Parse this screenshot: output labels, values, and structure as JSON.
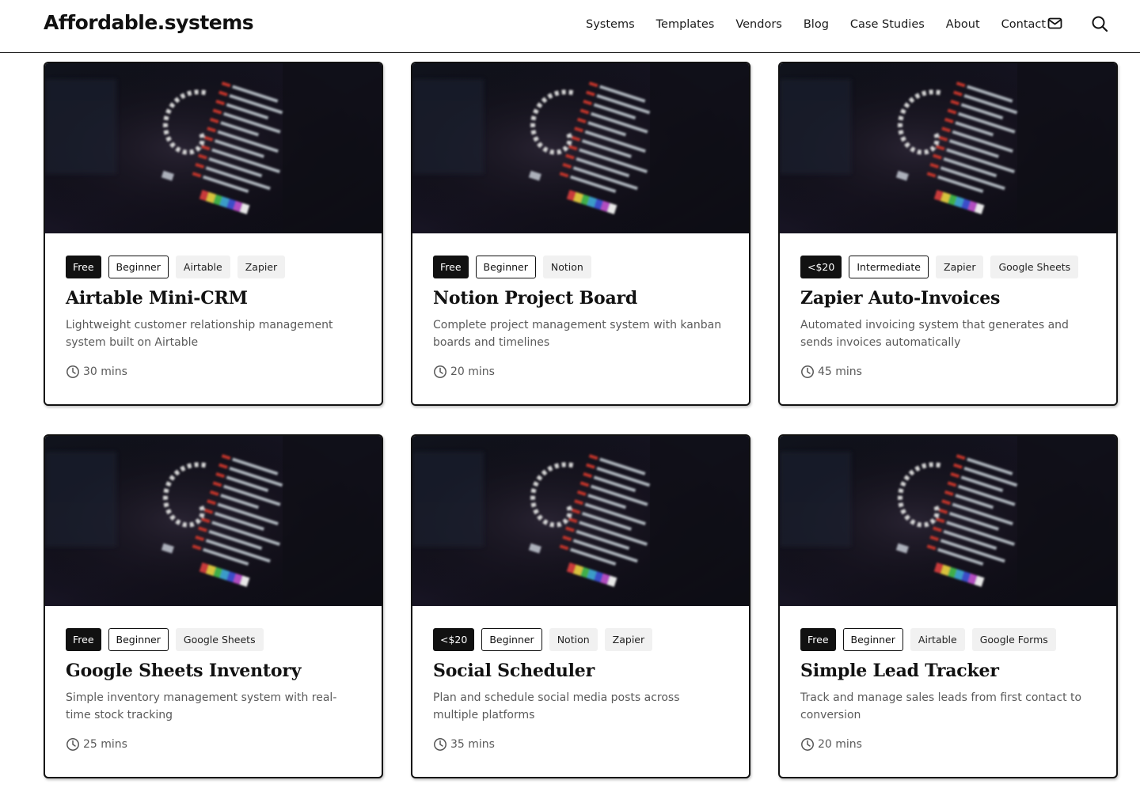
{
  "site": {
    "logo": "Affordable.systems"
  },
  "nav": {
    "links": [
      "Systems",
      "Templates",
      "Vendors",
      "Blog",
      "Case Studies",
      "About",
      "Contact"
    ],
    "mail_icon": "mail-icon",
    "search_icon": "search-icon"
  },
  "cards": [
    {
      "price": "Free",
      "level": "Beginner",
      "tools": [
        "Airtable",
        "Zapier"
      ],
      "title": "Airtable Mini-CRM",
      "description": "Lightweight customer relationship management system built on Airtable",
      "time": "30 mins"
    },
    {
      "price": "Free",
      "level": "Beginner",
      "tools": [
        "Notion"
      ],
      "title": "Notion Project Board",
      "description": "Complete project management system with kanban boards and timelines",
      "time": "20 mins"
    },
    {
      "price": "<$20",
      "level": "Intermediate",
      "tools": [
        "Zapier",
        "Google Sheets"
      ],
      "title": "Zapier Auto-Invoices",
      "description": "Automated invoicing system that generates and sends invoices automatically",
      "time": "45 mins"
    },
    {
      "price": "Free",
      "level": "Beginner",
      "tools": [
        "Google Sheets"
      ],
      "title": "Google Sheets Inventory",
      "description": "Simple inventory management system with real-time stock tracking",
      "time": "25 mins"
    },
    {
      "price": "<$20",
      "level": "Beginner",
      "tools": [
        "Notion",
        "Zapier"
      ],
      "title": "Social Scheduler",
      "description": "Plan and schedule social media posts across multiple platforms",
      "time": "35 mins"
    },
    {
      "price": "Free",
      "level": "Beginner",
      "tools": [
        "Airtable",
        "Google Forms"
      ],
      "title": "Simple Lead Tracker",
      "description": "Track and manage sales leads from first contact to conversion",
      "time": "20 mins"
    }
  ]
}
